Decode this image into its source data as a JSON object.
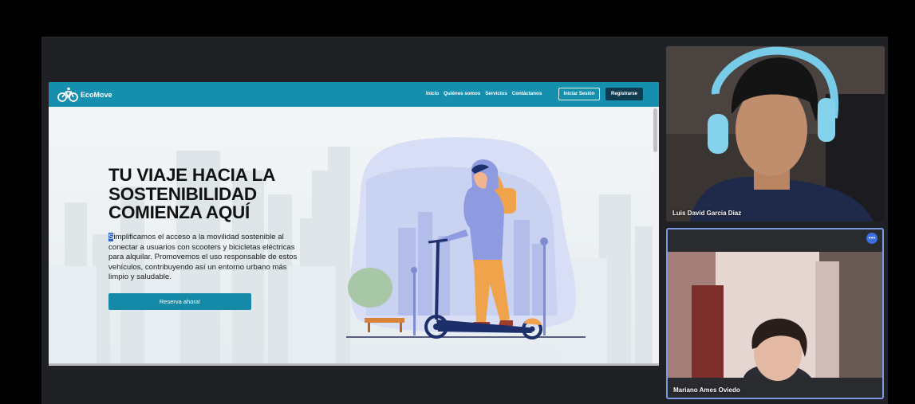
{
  "site": {
    "brand": "EcoMove",
    "nav": [
      "Inicio",
      "Quiénes somos",
      "Servicios",
      "Contáctanos"
    ],
    "login_label": "Iniciar Sesión",
    "register_label": "Registrarse",
    "hero_title_lines": [
      "TU VIAJE HACIA LA",
      "SOSTENIBILIDAD",
      "COMIENZA AQUÍ"
    ],
    "hero_desc_first_letter": "S",
    "hero_desc_rest": "implificamos el acceso a la movilidad sostenible al conectar a usuarios con scooters y bicicletas eléctricas para alquilar. Promovemos el uso responsable de estos vehículos, contribuyendo así un entorno urbano más limpio y saludable.",
    "cta_label": "Reserva ahora!"
  },
  "participants": [
    {
      "name": "Luis David Garcia Diaz"
    },
    {
      "name": "Mariano Ames Oviedo",
      "more_icon": "more-options-icon"
    }
  ],
  "colors": {
    "navbar": "#168fae",
    "cta": "#158aa8",
    "register_button": "#0f3b50",
    "active_speaker_border": "#7c99e3"
  }
}
